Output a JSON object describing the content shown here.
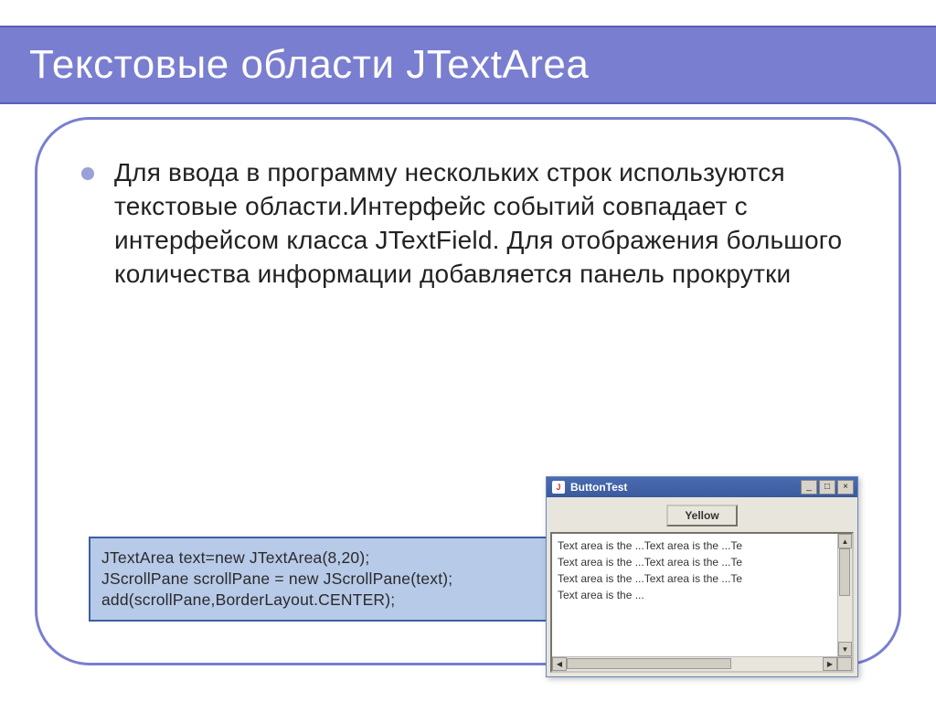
{
  "slide": {
    "title": "Текстовые области JTextArea",
    "bullet": "Для ввода в программу нескольких строк используются текстовые области.Интерфейс событий совпадает с интерфейсом класса JTextField. Для отображения большого количества информации добавляется панель прокрутки"
  },
  "code": {
    "line1": "JTextArea text=new JTextArea(8,20);",
    "line2": "JScrollPane scrollPane = new JScrollPane(text);",
    "line3": "add(scrollPane,BorderLayout.CENTER);"
  },
  "swing": {
    "window_title": "ButtonTest",
    "button_label": "Yellow",
    "java_icon_label": "J",
    "win_buttons": {
      "min": "_",
      "max": "□",
      "close": "×"
    },
    "scroll_arrows": {
      "up": "▲",
      "down": "▼",
      "left": "◀",
      "right": "▶"
    },
    "text_lines": [
      "Text area is the ...Text area is the ...Te",
      "Text area is the ...Text area is the ...Te",
      "Text area is the ...Text area is the ...Te",
      "Text area is the ..."
    ]
  }
}
